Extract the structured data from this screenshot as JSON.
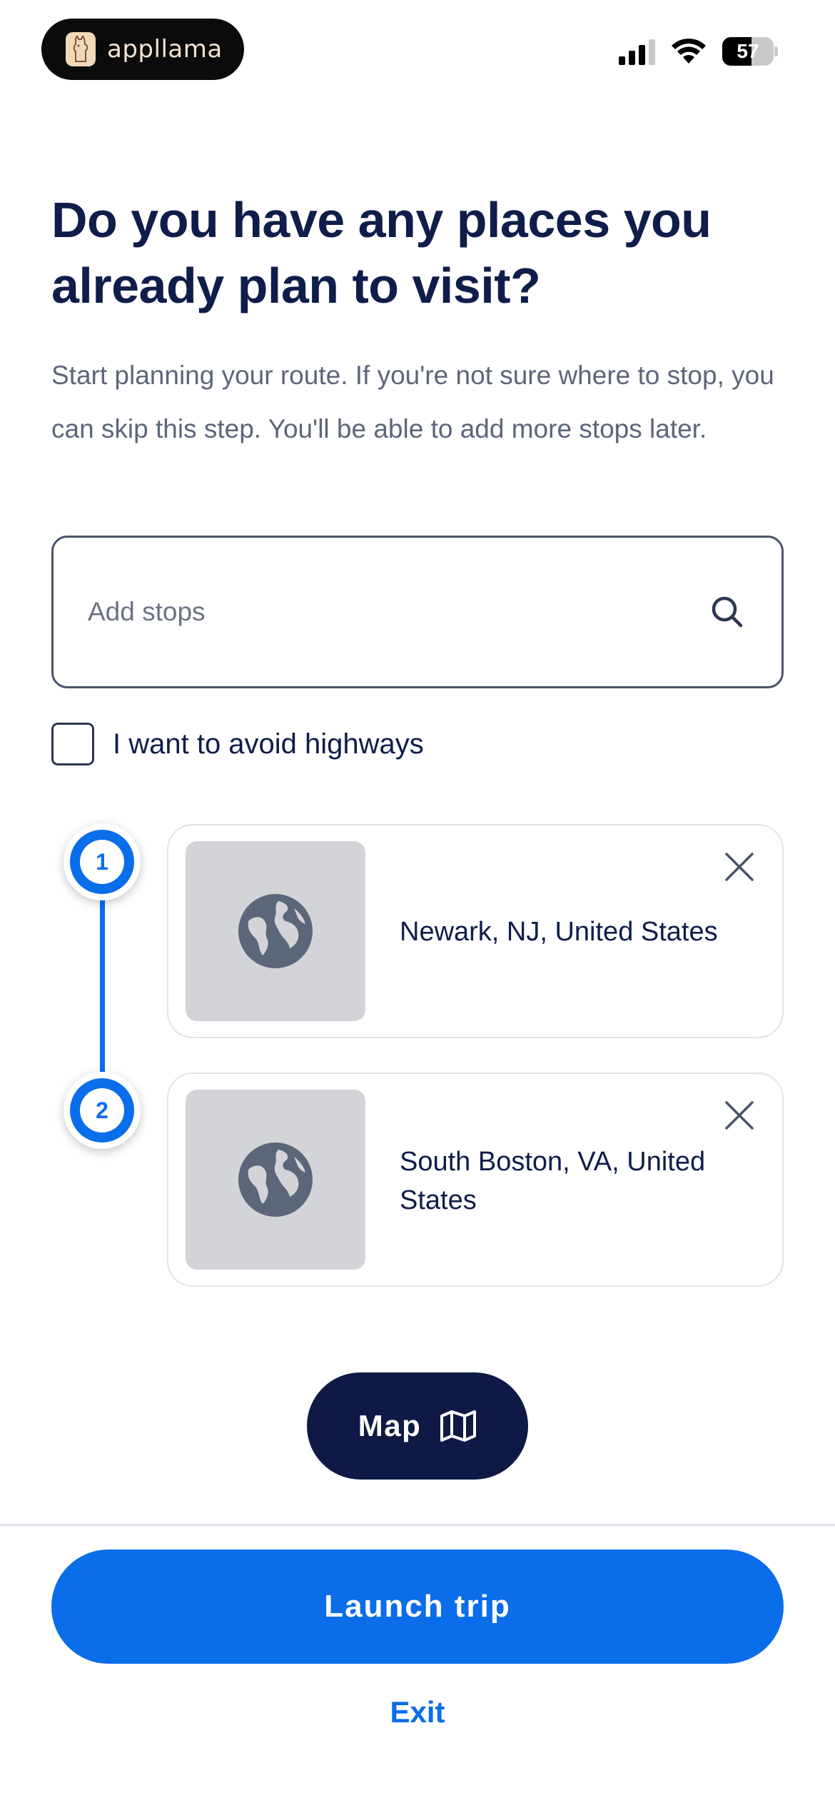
{
  "status_bar": {
    "brand_name": "appllama",
    "battery": "57",
    "battery_level": 0.57,
    "icons": [
      "signal-icon",
      "wifi-icon",
      "battery-icon"
    ]
  },
  "header": {
    "title": "Do you have any places you already plan to visit?",
    "subtitle": "Start planning your route. If you're not sure where to stop, you can skip this step. You'll be able to add more stops later."
  },
  "search": {
    "placeholder": "Add stops",
    "value": "",
    "icon": "search-icon"
  },
  "options": {
    "avoid_highways_label": "I want to avoid highways",
    "avoid_highways_checked": false
  },
  "stops": [
    {
      "number": "1",
      "name": "Newark, NJ, United States",
      "icon": "globe-icon"
    },
    {
      "number": "2",
      "name": "South Boston, VA, United States",
      "icon": "globe-icon"
    }
  ],
  "actions": {
    "map_label": "Map",
    "map_icon": "map-icon",
    "launch_label": "Launch trip",
    "exit_label": "Exit"
  },
  "colors": {
    "accent": "#0a6de9",
    "navy": "#0e1a45",
    "text": "#0f1d4a",
    "muted": "#5d6679"
  }
}
